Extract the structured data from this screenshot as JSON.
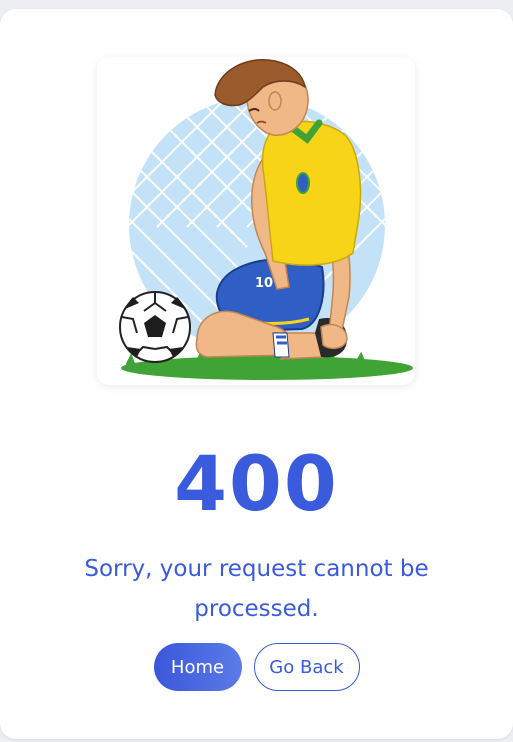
{
  "error": {
    "code": "400",
    "message": "Sorry, your request cannot be processed."
  },
  "actions": {
    "home_label": "Home",
    "back_label": "Go Back"
  },
  "illustration": {
    "subject": "sad soccer player kneeling by goal net",
    "jersey_number": "10",
    "colors": {
      "accent": "#3a5bdc",
      "jersey": "#f7d417",
      "shorts": "#2f5fc4",
      "grass": "#3fa336",
      "net_bg": "#c4e2f7"
    }
  }
}
